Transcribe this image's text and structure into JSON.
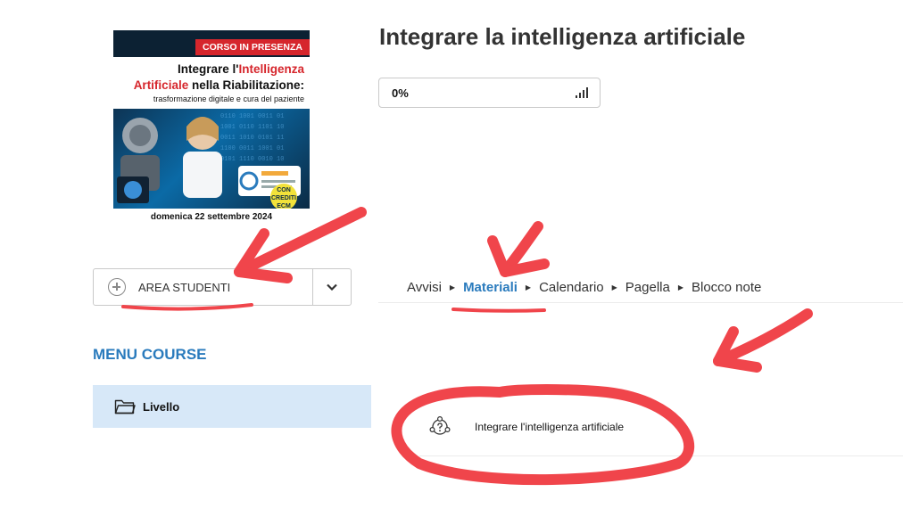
{
  "course_image": {
    "badge": "CORSO IN PRESENZA",
    "headline_1_before": "Integrare l'",
    "headline_1_highlight": "Intelligenza",
    "headline_2_highlight": "Artificiale",
    "headline_2_after": " nella Riabilitazione:",
    "subheadline": "trasformazione digitale e cura del paziente",
    "ecm_badge": "CON CREDITI ECM",
    "date": "domenica 22 settembre 2024"
  },
  "page_title": "Integrare la intelligenza artificiale",
  "progress": {
    "label": "0%",
    "value": 0
  },
  "area_studenti": {
    "label": "AREA STUDENTI",
    "icon": "plus-circle-icon",
    "dropdown_icon": "chevron-down-icon"
  },
  "menu_course": {
    "title": "MENU COURSE",
    "items": [
      {
        "label": "Livello",
        "icon": "folder-icon"
      }
    ]
  },
  "tabs": [
    {
      "label": "Avvisi",
      "active": false
    },
    {
      "label": "Materiali",
      "active": true
    },
    {
      "label": "Calendario",
      "active": false
    },
    {
      "label": "Pagella",
      "active": false
    },
    {
      "label": "Blocco note",
      "active": false
    }
  ],
  "resources": [
    {
      "label": "Integrare l'intelligenza artificiale",
      "icon": "quiz-icon"
    }
  ],
  "colors": {
    "accent": "#2a7bbd",
    "selected_bg": "#d7e8f8",
    "annotation": "#f0454b",
    "badge_red": "#d6262c"
  }
}
